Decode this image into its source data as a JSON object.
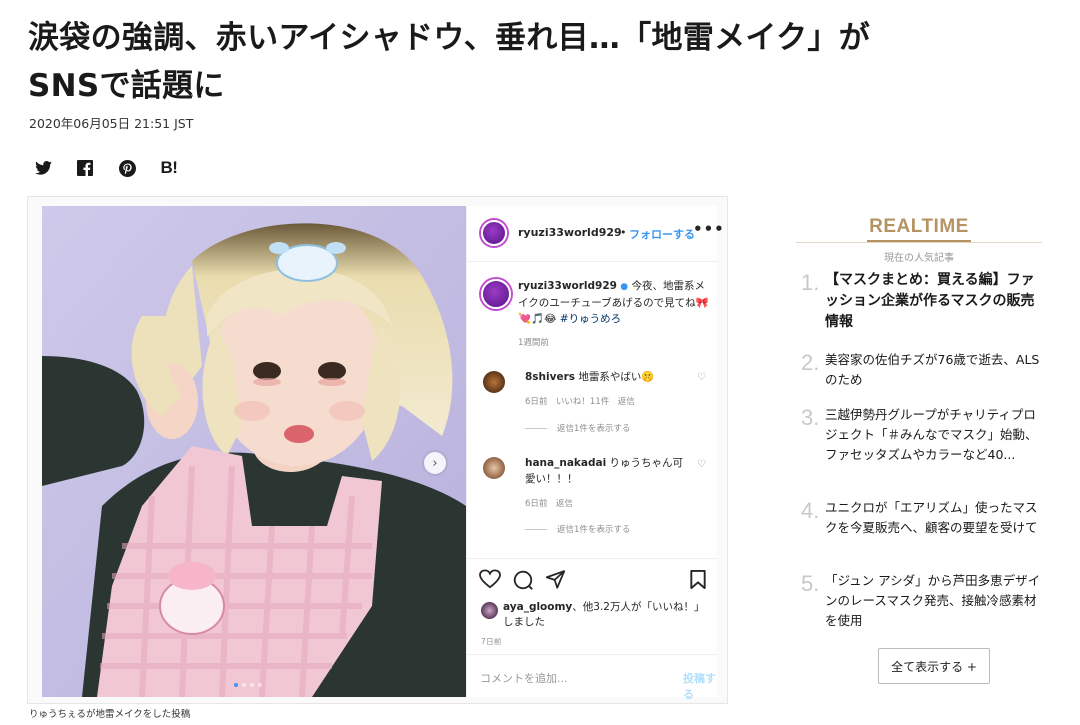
{
  "article": {
    "title_line1": "涙袋の強調、赤いアイシャドウ、垂れ目…「地雷メイク」が",
    "title_line2": "SNSで話題に",
    "date": "2020年06月05日 21:51 JST"
  },
  "share": {
    "icons": [
      "twitter-icon",
      "facebook-icon",
      "pinterest-icon",
      "hatena-bookmark-icon"
    ],
    "hatena_label": "B!"
  },
  "instagram": {
    "username": "ryuzi33world929",
    "follow_label": "フォローする",
    "more_label": "•••",
    "caption_user": "ryuzi33world929",
    "caption_text": "今夜、地雷系メイクのユーチューブあげるので見てね🎀💘🎵😂",
    "caption_hashtag": "#りゅうめろ",
    "caption_time": "1週間前",
    "comments": [
      {
        "user": "8shivers",
        "text": "地雷系やばい🤫",
        "meta": "6日前　いいね！11件　返信",
        "replies": "返信1件を表示する"
      },
      {
        "user": "hana_nakadai",
        "text": "りゅうちゃん可愛い！！！",
        "meta": "6日前　返信",
        "replies": "返信1件を表示する"
      }
    ],
    "likes_user": "aya_gloomy",
    "likes_text": "、他3.2万人が「いいね！」しました",
    "post_date": "7日前",
    "comment_placeholder": "コメントを追加...",
    "post_button": "投稿する",
    "follow_color": "#3897f0"
  },
  "photo_caption": "りゅうちぇるが地雷メイクをした投稿",
  "sidebar": {
    "heading": "REALTIME",
    "subheading": "現在の人気記事",
    "accent_color": "#b69363",
    "items": [
      {
        "num": "1.",
        "text": "【マスクまとめ：買える編】ファッション企業が作るマスクの販売情報"
      },
      {
        "num": "2.",
        "text": "美容家の佐伯チズが76歳で逝去、ALSのため"
      },
      {
        "num": "3.",
        "text": "三越伊勢丹グループがチャリティプロジェクト「＃みんなでマスク」始動、ファセッタズムやカラーなど40..."
      },
      {
        "num": "4.",
        "text": "ユニクロが「エアリズム」使ったマスクを今夏販売へ、顧客の要望を受けて"
      },
      {
        "num": "5.",
        "text": "「ジュン アシダ」から芦田多恵デザインのレースマスク発売、接触冷感素材を使用"
      }
    ],
    "show_all": "全て表示する +"
  }
}
